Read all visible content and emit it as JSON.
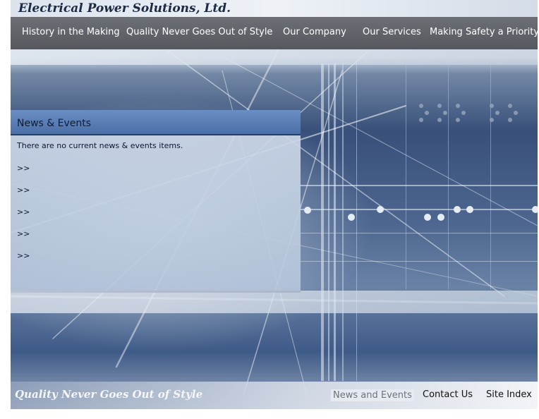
{
  "site": {
    "logo_text": "Electrical Power Solutions, Ltd."
  },
  "nav": {
    "items": [
      {
        "label": "History in the Making"
      },
      {
        "label": "Quality Never Goes Out of Style"
      },
      {
        "label": "Our Company"
      },
      {
        "label": "Our Services"
      },
      {
        "label": "Making Safety a Priority"
      }
    ]
  },
  "news": {
    "title": "News & Events",
    "empty_message": "There are no current news & events items.",
    "links": [
      ">>",
      ">>",
      ">>",
      ">>",
      ">>"
    ]
  },
  "footer": {
    "slogan": "Quality Never Goes Out of Style",
    "links": [
      {
        "label": "News and Events"
      },
      {
        "label": "Contact Us"
      },
      {
        "label": "Site Index"
      }
    ]
  },
  "colors": {
    "nav_bg": "#5f6268",
    "panel_header": "#5a7fb8",
    "panel_border": "#2a4570",
    "accent_text": "#0e1d36"
  }
}
